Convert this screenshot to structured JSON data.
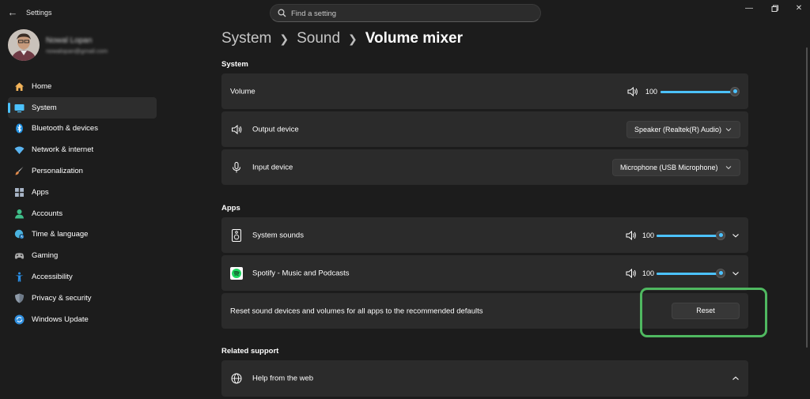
{
  "window": {
    "title": "Settings",
    "back_icon": "back-arrow-icon",
    "controls": [
      "minimize-icon",
      "maximize-icon",
      "close-icon"
    ]
  },
  "search": {
    "placeholder": "Find a setting",
    "icon": "search-icon"
  },
  "profile": {
    "name": "Nowal Lopan",
    "email": "nowalopan@gmail.com"
  },
  "sidebar": {
    "items": [
      {
        "label": "Home",
        "icon": "home-icon",
        "color": "#f2b35a"
      },
      {
        "label": "System",
        "icon": "monitor-icon",
        "color": "#4cc2ff",
        "active": true
      },
      {
        "label": "Bluetooth & devices",
        "icon": "bluetooth-icon",
        "color": "#1f8fe0"
      },
      {
        "label": "Network & internet",
        "icon": "wifi-icon",
        "color": "#5ab4f0"
      },
      {
        "label": "Personalization",
        "icon": "brush-icon",
        "color": "#e0894a"
      },
      {
        "label": "Apps",
        "icon": "apps-icon",
        "color": "#a9b6c8"
      },
      {
        "label": "Accounts",
        "icon": "person-icon",
        "color": "#3fbf8a"
      },
      {
        "label": "Time & language",
        "icon": "globe-clock-icon",
        "color": "#4ab3e0"
      },
      {
        "label": "Gaming",
        "icon": "gamepad-icon",
        "color": "#a8a8a8"
      },
      {
        "label": "Accessibility",
        "icon": "accessibility-icon",
        "color": "#2a8fe8"
      },
      {
        "label": "Privacy & security",
        "icon": "shield-icon",
        "color": "#8e9aa8"
      },
      {
        "label": "Windows Update",
        "icon": "update-icon",
        "color": "#2f8fe0"
      }
    ]
  },
  "breadcrumb": {
    "level1": "System",
    "level2": "Sound",
    "current": "Volume mixer"
  },
  "system_section": {
    "title": "System",
    "volume": {
      "label": "Volume",
      "value": "100",
      "level": 1.0
    },
    "output": {
      "label": "Output device",
      "value": "Speaker (Realtek(R) Audio)",
      "icon": "speaker-icon"
    },
    "input": {
      "label": "Input device",
      "value": "Microphone (USB Microphone)",
      "icon": "microphone-icon"
    }
  },
  "apps_section": {
    "title": "Apps",
    "apps": [
      {
        "label": "System sounds",
        "value": "100",
        "level": 1.0,
        "icon": "system-sounds-icon"
      },
      {
        "label": "Spotify - Music and Podcasts",
        "value": "100",
        "level": 1.0,
        "icon": "spotify-icon"
      }
    ],
    "reset": {
      "label": "Reset sound devices and volumes for all apps to the recommended defaults",
      "button": "Reset"
    }
  },
  "related_section": {
    "title": "Related support",
    "help": {
      "label": "Help from the web",
      "icon": "globe-icon"
    }
  },
  "colors": {
    "accent": "#4cc2ff",
    "highlight": "#4fb860",
    "card": "#2b2b2b",
    "background": "#1c1c1c"
  }
}
